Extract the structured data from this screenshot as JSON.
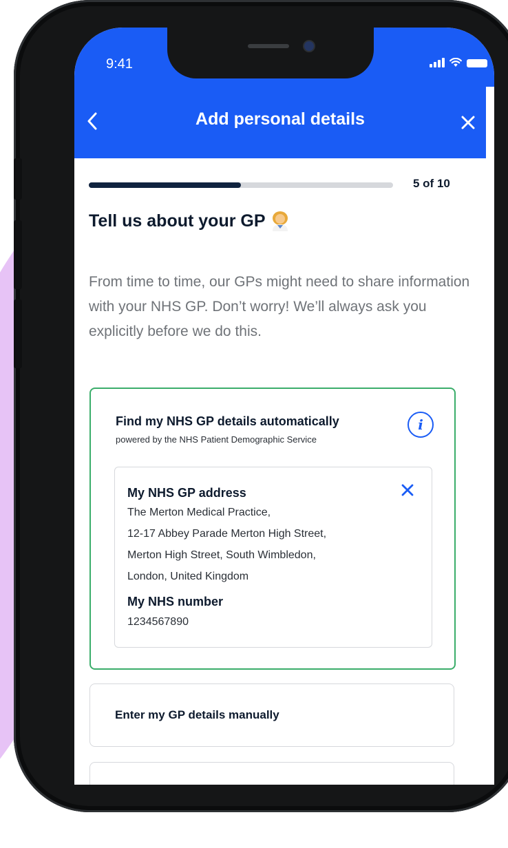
{
  "status_bar": {
    "time": "9:41"
  },
  "header": {
    "title": "Add personal details",
    "back_icon": "chevron-left-icon",
    "close_icon": "close-icon"
  },
  "progress": {
    "label": "5 of 10",
    "fraction": 0.5
  },
  "page": {
    "title": "Tell us about your GP",
    "emoji": "woman-health-worker-emoji",
    "intro": "From time to time, our GPs might need to share information with your NHS GP. Don’t worry! We’ll always ask you explicitly before we do this."
  },
  "auto_card": {
    "title": "Find my NHS GP details automatically",
    "subtitle": "powered by the NHS Patient Demographic Service",
    "info_icon": "info-icon",
    "address_title": "My NHS GP address",
    "address_lines": [
      "The Merton Medical Practice,",
      "12-17 Abbey Parade Merton High Street,",
      "Merton High Street, South Wimbledon,",
      "London, United Kingdom"
    ],
    "nhs_number_title": "My NHS number",
    "nhs_number": "1234567890"
  },
  "manual_card": {
    "label": "Enter my GP details manually"
  },
  "colors": {
    "brand_blue": "#1a5cf5",
    "selected_green": "#3aad6a",
    "progress_fill": "#10233f",
    "background_accent": "#e7c3f6"
  }
}
